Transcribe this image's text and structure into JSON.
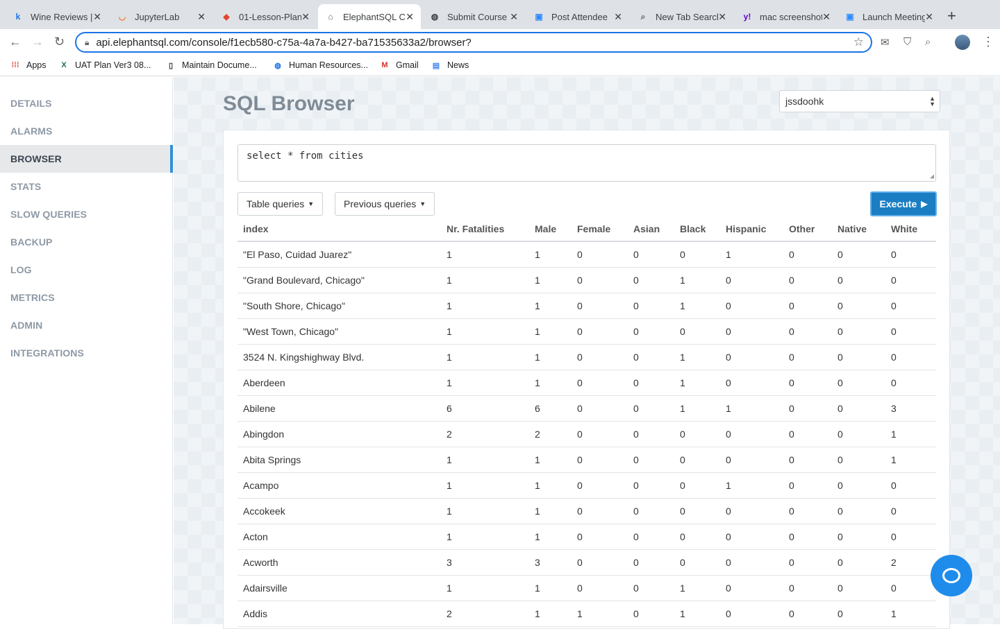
{
  "browser": {
    "tabs": [
      {
        "title": "Wine Reviews |",
        "icon": "k-icon",
        "icon_char": "k",
        "icon_color": "#1a73e8"
      },
      {
        "title": "JupyterLab",
        "icon": "jupyter-icon",
        "icon_char": "◡",
        "icon_color": "#f37626"
      },
      {
        "title": "01-Lesson-Plan",
        "icon": "gitlab-icon",
        "icon_char": "◆",
        "icon_color": "#e24329"
      },
      {
        "title": "ElephantSQL C",
        "icon": "elephant-icon",
        "icon_char": "⌂",
        "icon_color": "#5f6368"
      },
      {
        "title": "Submit Course",
        "icon": "globe-icon",
        "icon_char": "◍",
        "icon_color": "#3c4043"
      },
      {
        "title": "Post Attendee",
        "icon": "zoom-icon",
        "icon_char": "▣",
        "icon_color": "#2d8cff"
      },
      {
        "title": "New Tab Search",
        "icon": "search-icon",
        "icon_char": "⌕",
        "icon_color": "#5f6368"
      },
      {
        "title": "mac screenshot",
        "icon": "yahoo-icon",
        "icon_char": "y!",
        "icon_color": "#6001d2"
      },
      {
        "title": "Launch Meeting",
        "icon": "zoom-icon",
        "icon_char": "▣",
        "icon_color": "#2d8cff"
      }
    ],
    "active_tab_index": 3,
    "url": "api.elephantsql.com/console/f1ecb580-c75a-4a7a-b427-ba71535633a2/browser?",
    "bookmarks": [
      {
        "label": "Apps",
        "icon": "apps-grid-icon"
      },
      {
        "label": "UAT Plan Ver3 08...",
        "icon": "excel-icon"
      },
      {
        "label": "Maintain Docume...",
        "icon": "document-icon"
      },
      {
        "label": "Human Resources...",
        "icon": "globe-icon"
      },
      {
        "label": "Gmail",
        "icon": "gmail-icon"
      },
      {
        "label": "News",
        "icon": "news-icon"
      }
    ]
  },
  "sidebar": {
    "items": [
      {
        "label": "DETAILS",
        "active": false
      },
      {
        "label": "ALARMS",
        "active": false
      },
      {
        "label": "BROWSER",
        "active": true
      },
      {
        "label": "STATS",
        "active": false
      },
      {
        "label": "SLOW QUERIES",
        "active": false
      },
      {
        "label": "BACKUP",
        "active": false
      },
      {
        "label": "LOG",
        "active": false
      },
      {
        "label": "METRICS",
        "active": false
      },
      {
        "label": "ADMIN",
        "active": false
      },
      {
        "label": "INTEGRATIONS",
        "active": false
      }
    ]
  },
  "main": {
    "title": "SQL Browser",
    "database": "jssdoohk",
    "query": "select * from cities",
    "table_queries_label": "Table queries",
    "previous_queries_label": "Previous queries",
    "execute_label": "Execute",
    "results": {
      "columns": [
        "index",
        "Nr. Fatalities",
        "Male",
        "Female",
        "Asian",
        "Black",
        "Hispanic",
        "Other",
        "Native",
        "White"
      ],
      "rows": [
        [
          "\"El Paso, Cuidad Juarez\"",
          "1",
          "1",
          "0",
          "0",
          "0",
          "1",
          "0",
          "0",
          "0"
        ],
        [
          "\"Grand Boulevard, Chicago\"",
          "1",
          "1",
          "0",
          "0",
          "1",
          "0",
          "0",
          "0",
          "0"
        ],
        [
          "\"South Shore, Chicago\"",
          "1",
          "1",
          "0",
          "0",
          "1",
          "0",
          "0",
          "0",
          "0"
        ],
        [
          "\"West Town, Chicago\"",
          "1",
          "1",
          "0",
          "0",
          "0",
          "0",
          "0",
          "0",
          "0"
        ],
        [
          "3524 N. Kingshighway Blvd.",
          "1",
          "1",
          "0",
          "0",
          "1",
          "0",
          "0",
          "0",
          "0"
        ],
        [
          "Aberdeen",
          "1",
          "1",
          "0",
          "0",
          "1",
          "0",
          "0",
          "0",
          "0"
        ],
        [
          "Abilene",
          "6",
          "6",
          "0",
          "0",
          "1",
          "1",
          "0",
          "0",
          "3"
        ],
        [
          "Abingdon",
          "2",
          "2",
          "0",
          "0",
          "0",
          "0",
          "0",
          "0",
          "1"
        ],
        [
          "Abita Springs",
          "1",
          "1",
          "0",
          "0",
          "0",
          "0",
          "0",
          "0",
          "1"
        ],
        [
          "Acampo",
          "1",
          "1",
          "0",
          "0",
          "0",
          "1",
          "0",
          "0",
          "0"
        ],
        [
          "Accokeek",
          "1",
          "1",
          "0",
          "0",
          "0",
          "0",
          "0",
          "0",
          "0"
        ],
        [
          "Acton",
          "1",
          "1",
          "0",
          "0",
          "0",
          "0",
          "0",
          "0",
          "0"
        ],
        [
          "Acworth",
          "3",
          "3",
          "0",
          "0",
          "0",
          "0",
          "0",
          "0",
          "2"
        ],
        [
          "Adairsville",
          "1",
          "1",
          "0",
          "0",
          "1",
          "0",
          "0",
          "0",
          "0"
        ],
        [
          "Addis",
          "2",
          "1",
          "1",
          "0",
          "1",
          "0",
          "0",
          "0",
          "1"
        ]
      ]
    }
  },
  "colors": {
    "accent": "#1b7ec2",
    "sidebar_active_border": "#2f8fd6",
    "chat_bubble": "#1f8ceb"
  }
}
